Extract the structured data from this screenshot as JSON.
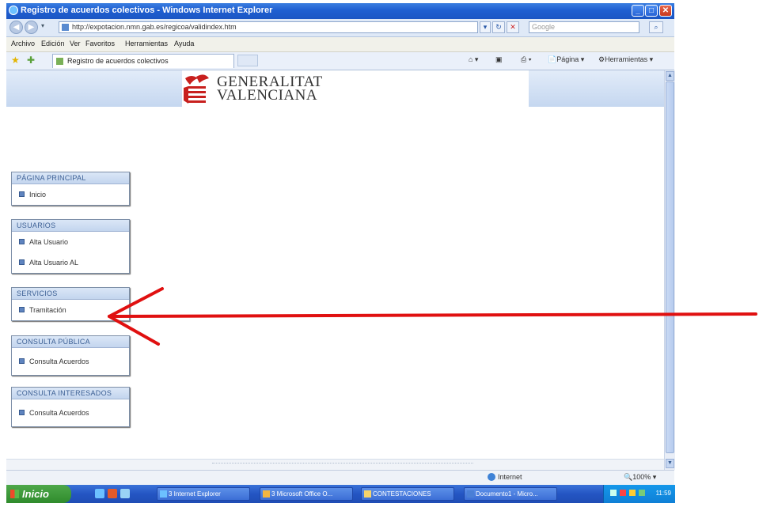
{
  "window": {
    "title": "Registro de acuerdos colectivos - Windows Internet Explorer",
    "controls": {
      "minimize": "_",
      "maximize": "□",
      "close": "✕"
    }
  },
  "address_bar": {
    "url": "http://expotacion.nmn.gab.es/regicoa/validindex.htm",
    "search_placeholder": "Google",
    "go_label": "▾",
    "refresh_label": "↻",
    "stop_label": "✕",
    "search_go": "⌕"
  },
  "menubar": {
    "items": [
      "Archivo",
      "Edición",
      "Ver",
      "Favoritos",
      "Herramientas",
      "Ayuda"
    ]
  },
  "tabbar": {
    "tab_title": "Registro de acuerdos colectivos",
    "commands": {
      "page": "Página",
      "tools": "Herramientas"
    }
  },
  "page": {
    "logo": {
      "line1": "GENERALITAT",
      "line2": "VALENCIANA"
    },
    "menus": [
      {
        "heading": "PÁGINA PRINCIPAL",
        "items": [
          "Inicio"
        ]
      },
      {
        "heading": "USUARIOS",
        "items": [
          "Alta Usuario",
          "Alta Usuario AL"
        ]
      },
      {
        "heading": "SERVICIOS",
        "items": [
          "Tramitación"
        ]
      },
      {
        "heading": "CONSULTA PÚBLICA",
        "items": [
          "Consulta Acuerdos"
        ]
      },
      {
        "heading": "CONSULTA INTERESADOS",
        "items": [
          "Consulta Acuerdos"
        ]
      }
    ]
  },
  "statusbar": {
    "zone": "Internet",
    "zoom": "100%"
  },
  "taskbar": {
    "start_label": "Inicio",
    "tasks": [
      "3 Internet Explorer",
      "3 Microsoft Office O...",
      "CONTESTACIONES",
      "Documento1 - Micro..."
    ],
    "clock": "11:59"
  },
  "colors": {
    "titlebar": "#1f5fd1",
    "menu_heading": "#3b5f94",
    "annotation_arrow": "#e01010",
    "logo_red": "#c8201e"
  }
}
